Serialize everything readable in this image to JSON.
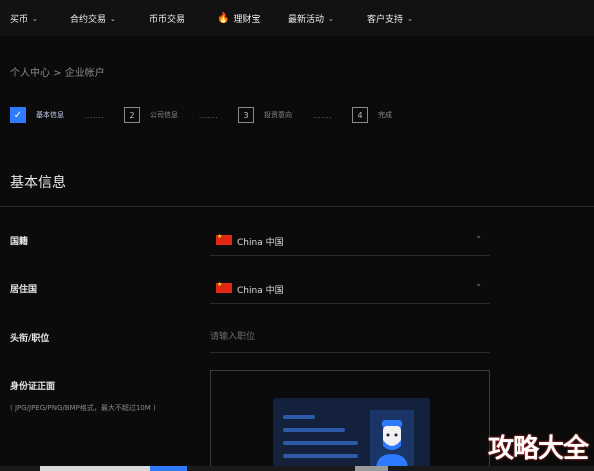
{
  "nav": {
    "buy": "买币",
    "contract": "合约交易",
    "spot": "币币交易",
    "wealth": "理财宝",
    "events": "最新活动",
    "support": "客户支持"
  },
  "breadcrumb": "个人中心 > 企业帐户",
  "steps": [
    {
      "num": "✓",
      "label": "基本信息"
    },
    {
      "num": "2",
      "label": "公司信息"
    },
    {
      "num": "3",
      "label": "投资意向"
    },
    {
      "num": "4",
      "label": "完成"
    }
  ],
  "step_dots": "·······",
  "section_title": "基本信息",
  "form": {
    "nationality": {
      "label": "国籍",
      "value": "China 中国"
    },
    "residence": {
      "label": "居住国",
      "value": "China 中国"
    },
    "title": {
      "label": "头衔/职位",
      "placeholder": "请输入职位"
    },
    "id_front": {
      "label": "身份证正面",
      "hint": "( JPG/JPEG/PNG/BMP格式，最大不超过10M )"
    }
  },
  "watermark": "攻略大全",
  "colors": {
    "accent": "#2f7bff",
    "background": "#0b0b0b",
    "flag": "#de2910"
  }
}
